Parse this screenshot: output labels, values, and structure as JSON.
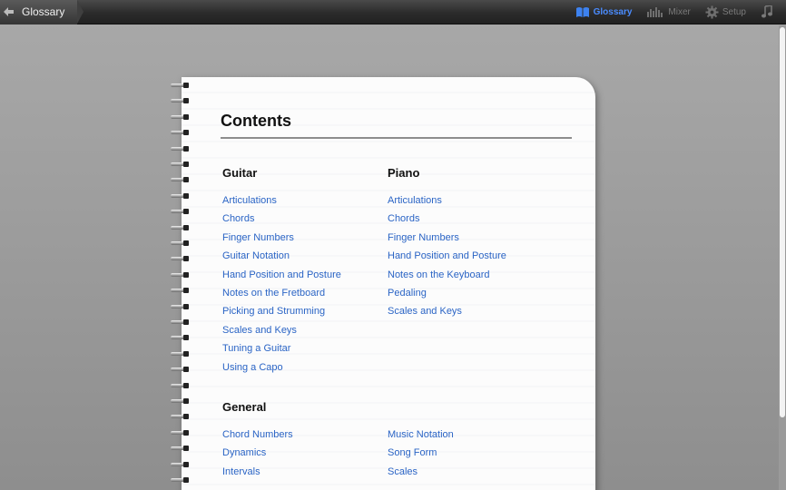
{
  "toolbar": {
    "back_label": "Glossary",
    "items": [
      {
        "label": "Glossary",
        "icon": "book-icon",
        "active": true
      },
      {
        "label": "Mixer",
        "icon": "mixer-icon",
        "active": false
      },
      {
        "label": "Setup",
        "icon": "gear-icon",
        "active": false
      }
    ],
    "accent_color": "#4a8cff"
  },
  "page": {
    "title": "Contents",
    "sections": {
      "guitar": {
        "heading": "Guitar",
        "links": [
          "Articulations",
          "Chords",
          "Finger Numbers",
          "Guitar Notation",
          "Hand Position and Posture",
          "Notes on the Fretboard",
          "Picking and Strumming",
          "Scales and Keys",
          "Tuning a Guitar",
          "Using a Capo"
        ]
      },
      "piano": {
        "heading": "Piano",
        "links": [
          "Articulations",
          "Chords",
          "Finger Numbers",
          "Hand Position and Posture",
          "Notes on the Keyboard",
          "Pedaling",
          "Scales and Keys"
        ]
      },
      "general": {
        "heading": "General",
        "col1": [
          "Chord Numbers",
          "Dynamics",
          "Intervals"
        ],
        "col2": [
          "Music Notation",
          "Song Form",
          "Scales"
        ]
      }
    },
    "link_color": "#2a64c5"
  }
}
